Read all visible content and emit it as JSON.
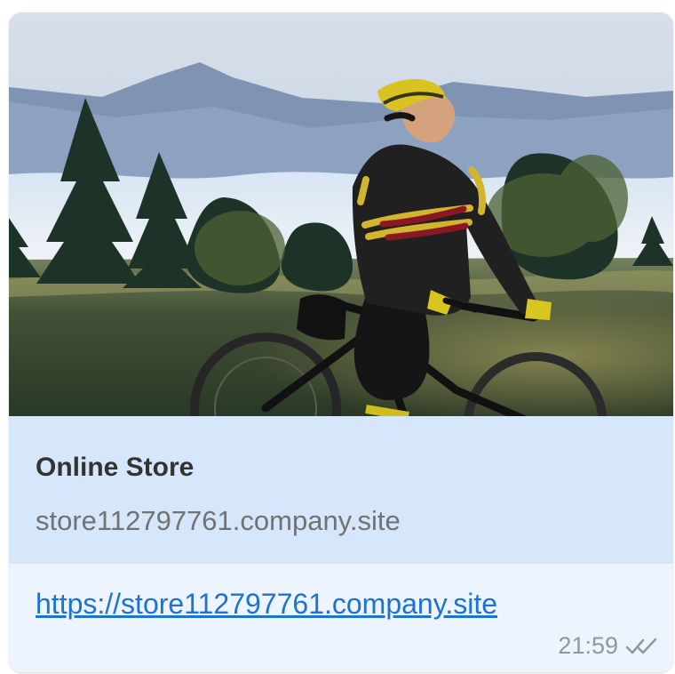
{
  "preview": {
    "image": "photo-of-cyclist-on-mountain-bike",
    "title": "Online Store",
    "host": "store112797761.company.site"
  },
  "message": {
    "link": "https://store112797761.company.site",
    "time": "21:59",
    "status_icon": "double-check-icon"
  },
  "colors": {
    "preview_card": "#d7e7fb",
    "bubble": "#eef4fd",
    "link": "#1b73d2"
  }
}
